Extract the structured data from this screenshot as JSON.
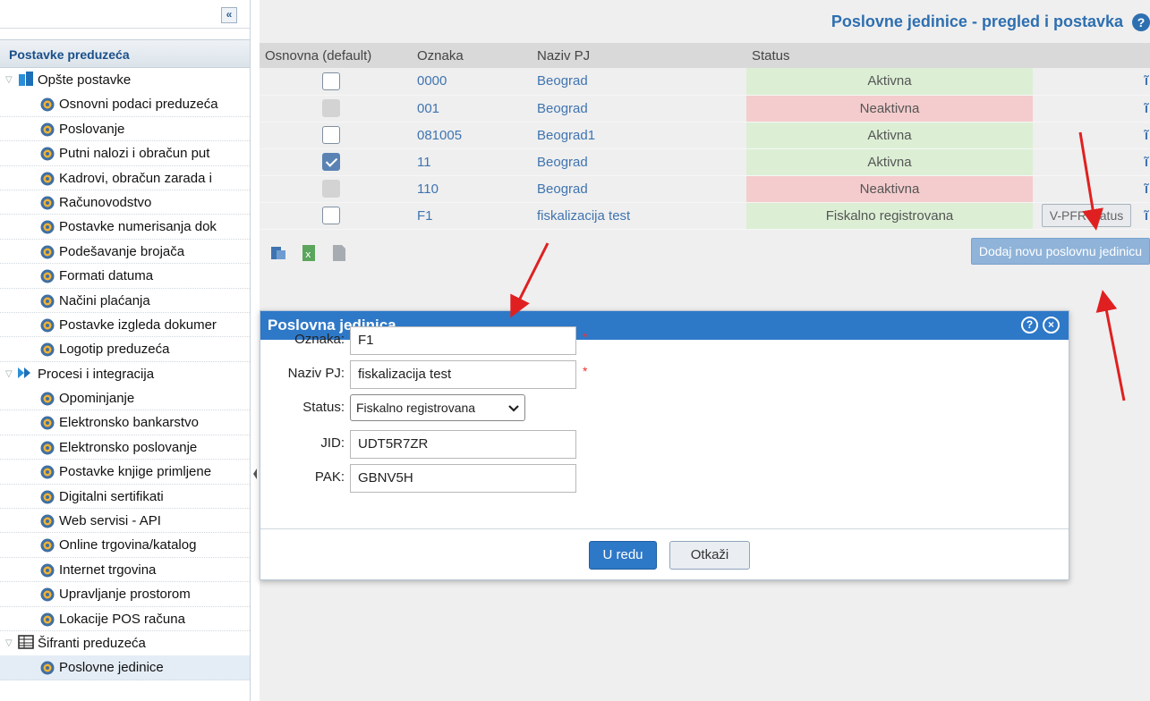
{
  "sidebar": {
    "collapse_label": "«",
    "header": "Postavke preduzeća",
    "groups": [
      {
        "label": "Opšte postavke",
        "icon": "building-icon",
        "items": [
          "Osnovni podaci preduzeća",
          "Poslovanje",
          "Putni nalozi i obračun put",
          "Kadrovi, obračun zarada i",
          "Računovodstvo",
          "Postavke numerisanja dok",
          "Podešavanje brojača",
          "Formati datuma",
          "Načini plaćanja",
          "Postavke izgleda dokumer",
          "Logotip preduzeća"
        ]
      },
      {
        "label": "Procesi i integracija",
        "icon": "arrows-icon",
        "items": [
          "Opominjanje",
          "Elektronsko bankarstvo",
          "Elektronsko poslovanje",
          "Postavke knjige primljene",
          "Digitalni sertifikati",
          "Web servisi - API",
          "Online trgovina/katalog",
          "Internet trgovina",
          "Upravljanje prostorom",
          "Lokacije POS računa"
        ]
      },
      {
        "label": "Šifranti preduzeća",
        "icon": "table-icon",
        "items": [
          "Poslovne jedinice"
        ]
      }
    ]
  },
  "main": {
    "title": "Poslovne jedinice - pregled i postavka",
    "help": "?",
    "columns": [
      "Osnovna (default)",
      "Oznaka",
      "Naziv PJ",
      "Status"
    ],
    "rows": [
      {
        "default": "unchecked",
        "code": "0000",
        "name": "Beograd",
        "status": "Aktivna",
        "state": "ok"
      },
      {
        "default": "disabled",
        "code": "001",
        "name": "Beograd",
        "status": "Neaktivna",
        "state": "bad"
      },
      {
        "default": "unchecked",
        "code": "081005",
        "name": "Beograd1",
        "status": "Aktivna",
        "state": "ok"
      },
      {
        "default": "checked",
        "code": "11",
        "name": "Beograd",
        "status": "Aktivna",
        "state": "ok"
      },
      {
        "default": "disabled",
        "code": "110",
        "name": "Beograd",
        "status": "Neaktivna",
        "state": "bad"
      },
      {
        "default": "unchecked",
        "code": "F1",
        "name": "fiskalizacija test",
        "status": "Fiskalno registrovana",
        "state": "ok",
        "action": "V-PFR status"
      }
    ],
    "trash_glyph": "ĩ",
    "add_button": "Dodaj novu poslovnu jedinicu"
  },
  "dialog": {
    "title": "Poslovna jedinica",
    "fields": {
      "oznaka_label": "Oznaka:",
      "oznaka_value": "F1",
      "naziv_label": "Naziv PJ:",
      "naziv_value": "fiskalizacija test",
      "status_label": "Status:",
      "status_value": "Fiskalno registrovana",
      "jid_label": "JID:",
      "jid_value": "UDT5R7ZR",
      "pak_label": "PAK:",
      "pak_value": "GBNV5H"
    },
    "required_mark": "*",
    "ok": "U redu",
    "cancel": "Otkaži"
  },
  "colors": {
    "accent": "#2e78c8",
    "active": "#dcefd5",
    "inactive": "#f4cccd",
    "arrow": "#e02020"
  }
}
